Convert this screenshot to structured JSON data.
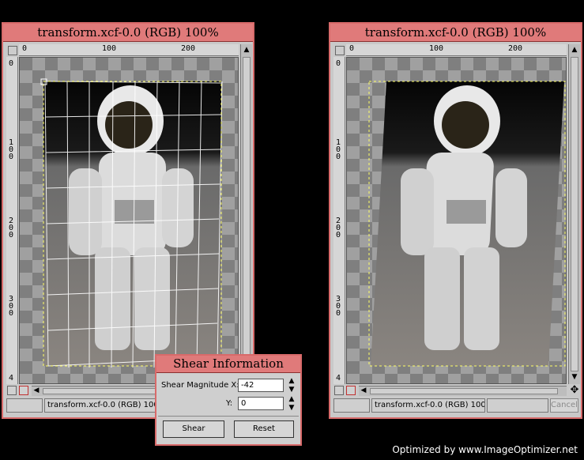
{
  "left_window": {
    "title": "transform.xcf-0.0 (RGB) 100%",
    "ruler_h_labels": [
      "0",
      "100",
      "200"
    ],
    "ruler_v_labels": [
      "0",
      "1\n0\n0",
      "2\n0\n0",
      "3\n0\n0",
      "4"
    ],
    "status_text": "transform.xcf-0.0 (RGB) 100"
  },
  "right_window": {
    "title": "transform.xcf-0.0 (RGB) 100%",
    "ruler_h_labels": [
      "0",
      "100",
      "200"
    ],
    "ruler_v_labels": [
      "0",
      "1\n0\n0",
      "2\n0\n0",
      "3\n0\n0",
      "4"
    ],
    "status_text": "transform.xcf-0.0 (RGB) 100",
    "cancel_label": "Cancel"
  },
  "shear_dialog": {
    "title": "Shear Information",
    "magnitude_x_label": "Shear Magnitude X:",
    "magnitude_x_value": "-42",
    "y_label": "Y:",
    "y_value": "0",
    "shear_button": "Shear",
    "reset_button": "Reset"
  },
  "watermark": "Optimized by www.ImageOptimizer.net",
  "colors": {
    "title_bar": "#e07a7a",
    "window_border": "#d86a6a",
    "background": "#000000"
  }
}
